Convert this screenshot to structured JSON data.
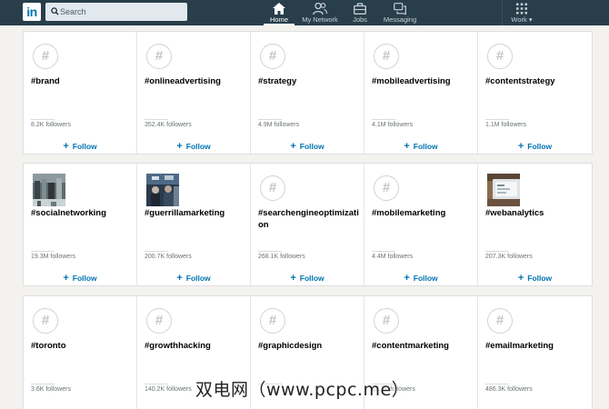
{
  "topbar": {
    "logo_text": "in",
    "search_placeholder": "Search",
    "nav": [
      {
        "label": "Home",
        "icon": "home-icon",
        "active": true
      },
      {
        "label": "My Network",
        "icon": "network-icon",
        "active": false
      },
      {
        "label": "Jobs",
        "icon": "briefcase-icon",
        "active": false
      },
      {
        "label": "Messaging",
        "icon": "messaging-icon",
        "active": false
      }
    ],
    "work_label": "Work ▾"
  },
  "follow_label": "Follow",
  "rows": [
    [
      {
        "tag": "#brand",
        "followers": "8.2K followers",
        "image": false
      },
      {
        "tag": "#onlineadvertising",
        "followers": "352.4K followers",
        "image": false
      },
      {
        "tag": "#strategy",
        "followers": "4.9M followers",
        "image": false
      },
      {
        "tag": "#mobileadvertising",
        "followers": "4.1M followers",
        "image": false
      },
      {
        "tag": "#contentstrategy",
        "followers": "1.1M followers",
        "image": false
      }
    ],
    [
      {
        "tag": "#socialnetworking",
        "followers": "19.3M followers",
        "image": true
      },
      {
        "tag": "#guerrillamarketing",
        "followers": "200.7K followers",
        "image": true
      },
      {
        "tag": "#searchengineoptimization",
        "followers": "268.1K followers",
        "image": false
      },
      {
        "tag": "#mobilemarketing",
        "followers": "4.4M followers",
        "image": false
      },
      {
        "tag": "#webanalytics",
        "followers": "207.3K followers",
        "image": true
      }
    ],
    [
      {
        "tag": "#toronto",
        "followers": "3.6K followers",
        "image": false
      },
      {
        "tag": "#growthhacking",
        "followers": "140.2K followers",
        "image": false
      },
      {
        "tag": "#graphicdesign",
        "followers": "",
        "image": false
      },
      {
        "tag": "#contentmarketing",
        "followers": "23.1K followers",
        "image": false
      },
      {
        "tag": "#emailmarketing",
        "followers": "486.3K followers",
        "image": false
      }
    ]
  ],
  "watermark": "双电网（www.pcpc.me）"
}
